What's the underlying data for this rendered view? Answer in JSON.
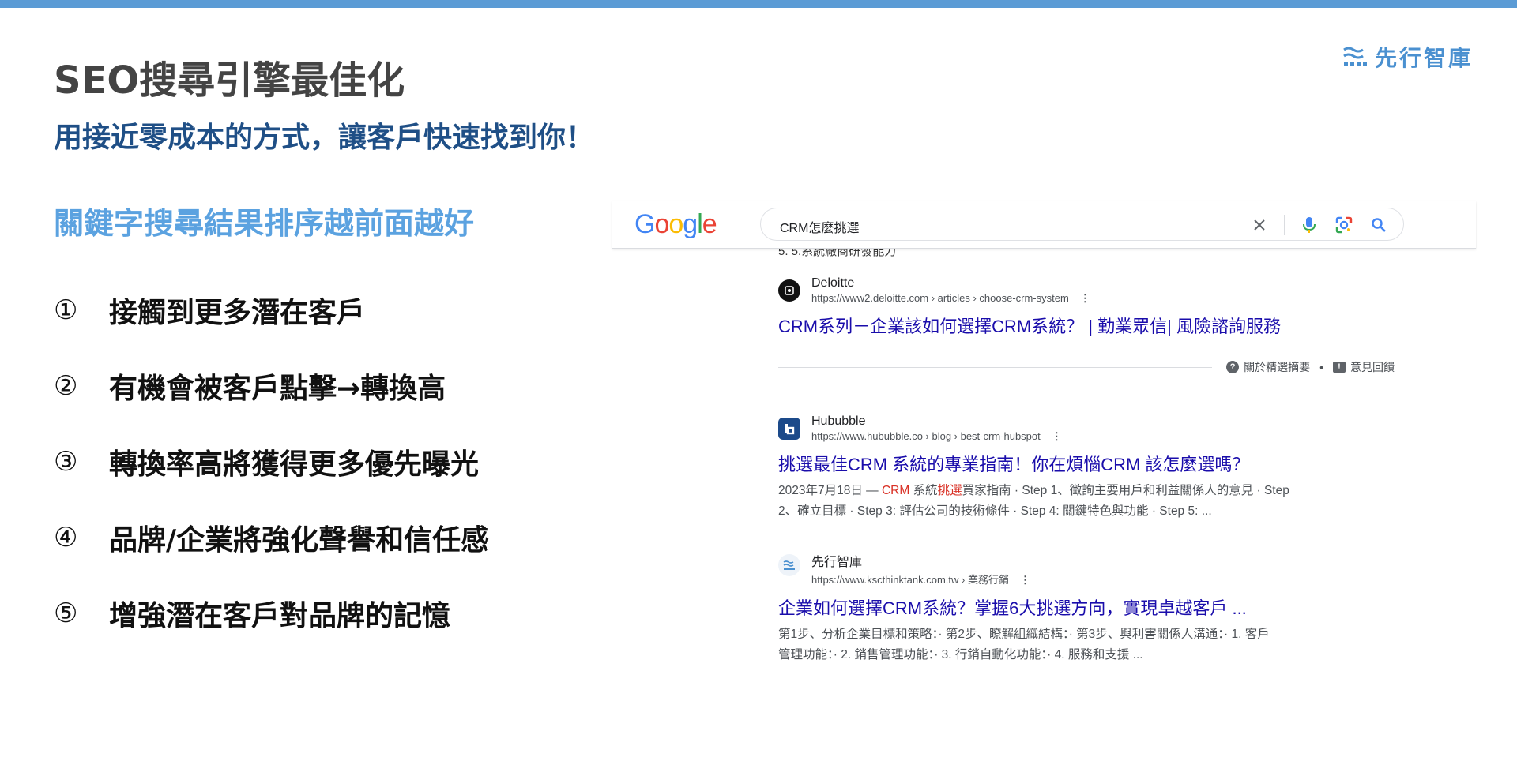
{
  "brand": {
    "name": "先行智庫",
    "logo_icon": "kscthinktank-logo-icon",
    "color": "#4a90d0"
  },
  "slide": {
    "title": "SEO搜尋引擎最佳化",
    "subtitle": "用接近零成本的方式，讓客戶快速找到你！",
    "section_heading": "關鍵字搜尋結果排序越前面越好",
    "points": [
      {
        "num": "①",
        "text": "接觸到更多潛在客戶"
      },
      {
        "num": "②",
        "text": "有機會被客戶點擊→轉換高"
      },
      {
        "num": "③",
        "text": "轉換率高將獲得更多優先曝光"
      },
      {
        "num": "④",
        "text": "品牌/企業將強化聲譽和信任感"
      },
      {
        "num": "⑤",
        "text": "增強潛在客戶對品牌的記憶"
      }
    ]
  },
  "serp": {
    "logo_text": "Google",
    "query": "CRM怎麼挑選",
    "clipped_line": "5. 5.系統廠商研發能力",
    "about_snippet": "關於精選摘要",
    "feedback": "意見回饋",
    "results": [
      {
        "site": "Deloitte",
        "url": "https://www2.deloitte.com › articles › choose-crm-system",
        "title": "CRM系列－企業該如何選擇CRM系統？ | 勤業眾信| 風險諮詢服務",
        "snippet_line1_pre": "",
        "snippet_line1_hl1": "",
        "snippet_line1_mid": "",
        "snippet_line1_hl2": "",
        "snippet_line1_post": "",
        "snippet_line2": ""
      },
      {
        "site": "Hububble",
        "url": "https://www.hububble.co › blog › best-crm-hubspot",
        "title": "挑選最佳CRM 系統的專業指南！你在煩惱CRM 該怎麼選嗎？",
        "snippet_line1_pre": "2023年7月18日 — ",
        "snippet_line1_hl1": "CRM",
        "snippet_line1_mid": " 系統",
        "snippet_line1_hl2": "挑選",
        "snippet_line1_post": "買家指南 · Step 1、徵詢主要用戶和利益關係人的意見 · Step",
        "snippet_line2": "2、確立目標 · Step 3: 評估公司的技術條件 · Step 4: 關鍵特色與功能 · Step 5: ..."
      },
      {
        "site": "先行智庫",
        "url": "https://www.kscthinktank.com.tw › 業務行銷",
        "title": "企業如何選擇CRM系統？掌握6大挑選方向，實現卓越客戶 ...",
        "snippet_line1": "第1步、分析企業目標和策略：· 第2步、瞭解組織結構：· 第3步、與利害關係人溝通：· 1. 客戶",
        "snippet_line2": "管理功能：· 2. 銷售管理功能：· 3. 行銷自動化功能：· 4. 服務和支援 ..."
      }
    ]
  }
}
